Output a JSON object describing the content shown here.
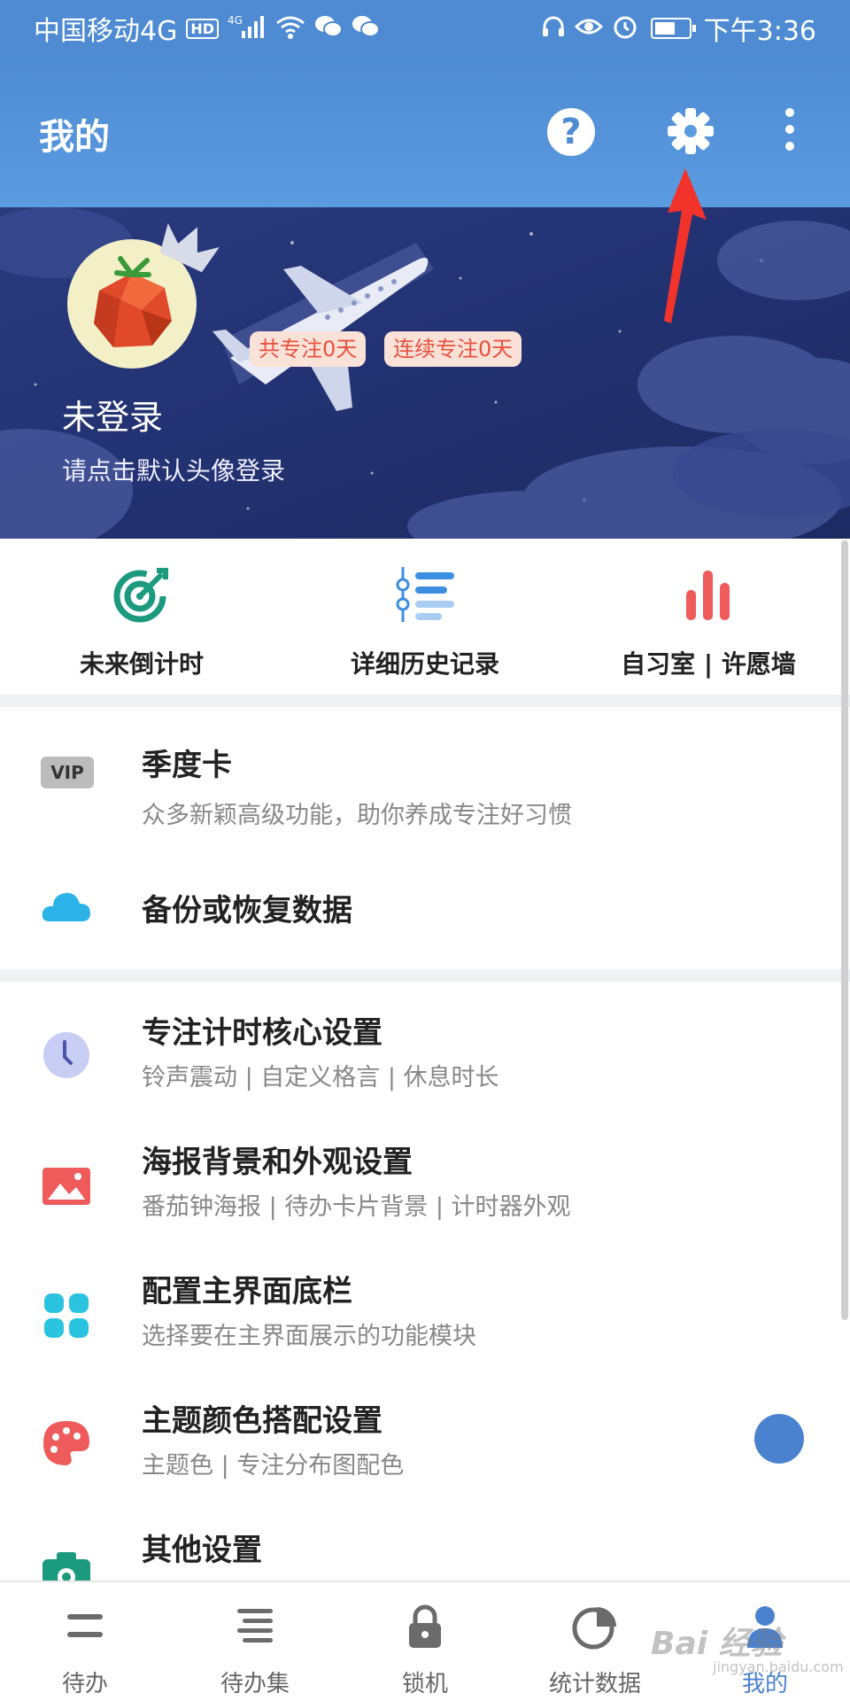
{
  "statusbar": {
    "carrier": "中国移动4G",
    "hd": "HD",
    "signal": "4G",
    "time": "下午3:36"
  },
  "header": {
    "title": "我的"
  },
  "profile": {
    "tag_total": "共专注0天",
    "tag_streak": "连续专注0天",
    "name": "未登录",
    "hint": "请点击默认头像登录"
  },
  "quick": [
    {
      "label": "未来倒计时",
      "icon": "target-icon",
      "color": "#1b9a7e"
    },
    {
      "label": "详细历史记录",
      "icon": "timeline-list-icon",
      "color": "#3c8fe0"
    },
    {
      "label": "自习室 | 许愿墙",
      "icon": "bar-chart-icon",
      "color": "#ef5b5b"
    }
  ],
  "menu": {
    "vip": {
      "badge": "VIP",
      "title": "季度卡",
      "sub": "众多新颖高级功能，助你养成专注好习惯"
    },
    "backup": {
      "title": "备份或恢复数据"
    },
    "core": {
      "title": "专注计时核心设置",
      "sub": "铃声震动 | 自定义格言 | 休息时长"
    },
    "poster": {
      "title": "海报背景和外观设置",
      "sub": "番茄钟海报 | 待办卡片背景 | 计时器外观"
    },
    "dock": {
      "title": "配置主界面底栏",
      "sub": "选择要在主界面展示的功能模块"
    },
    "theme": {
      "title": "主题颜色搭配设置",
      "sub": "主题色 | 专注分布图配色"
    },
    "other": {
      "title": "其他设置"
    }
  },
  "tabs": [
    {
      "label": "待办",
      "icon": "todo-icon"
    },
    {
      "label": "待办集",
      "icon": "todo-set-icon"
    },
    {
      "label": "锁机",
      "icon": "lock-icon"
    },
    {
      "label": "统计数据",
      "icon": "pie-chart-icon"
    },
    {
      "label": "我的",
      "icon": "person-icon",
      "active": true
    }
  ],
  "colors": {
    "primary": "#4e8bd3",
    "accent": "#4a82cf",
    "tag_text": "#e8513c",
    "arrow": "#f2332b"
  },
  "watermark": {
    "brand": "Bai 经验",
    "url": "jingyan.baidu.com"
  }
}
